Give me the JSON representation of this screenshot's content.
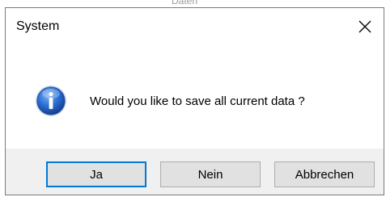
{
  "background": {
    "fragment_text": "Daten"
  },
  "dialog": {
    "title": "System",
    "close_icon": "close-icon",
    "info_icon": "info-icon",
    "message": "Would you like to save all current data ?",
    "buttons": {
      "yes_label": "Ja",
      "no_label": "Nein",
      "cancel_label": "Abbrechen"
    },
    "colors": {
      "default_button_border": "#0078d7",
      "button_face": "#e1e1e1",
      "footer_background": "#f0f0f0",
      "icon_blue": "#1f63c6"
    }
  }
}
